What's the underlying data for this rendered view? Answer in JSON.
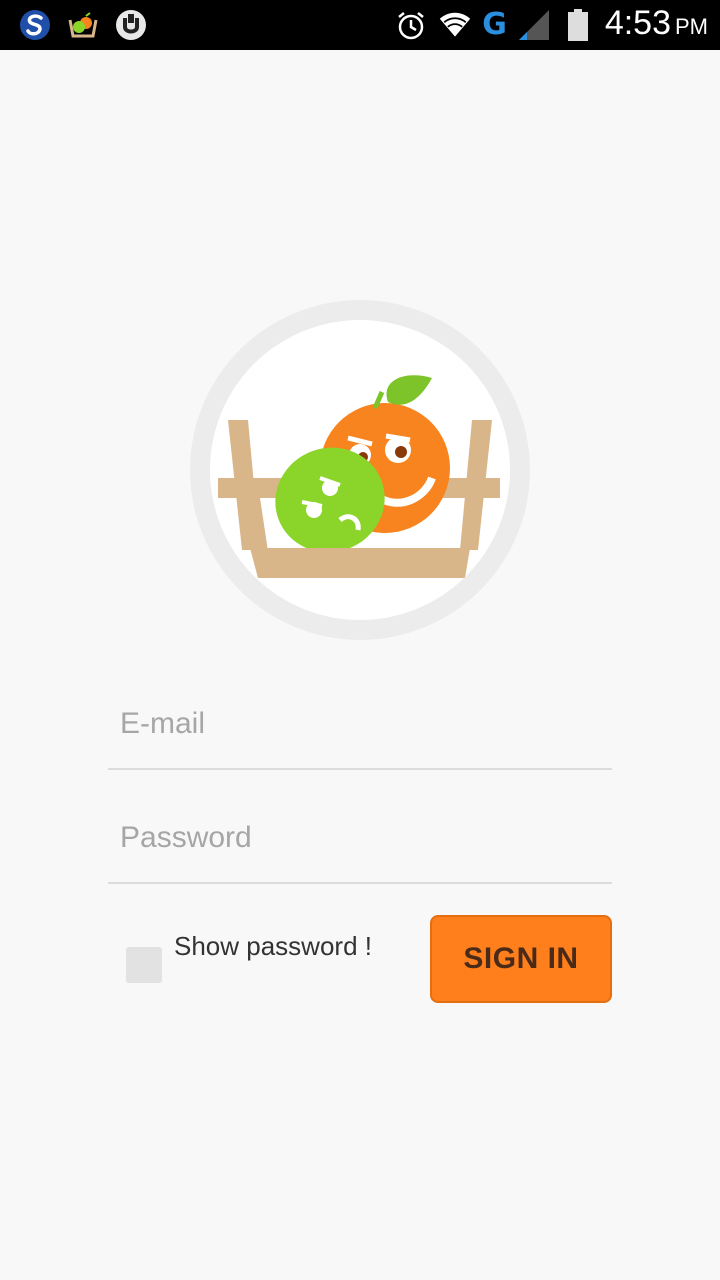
{
  "status_bar": {
    "left_icons": [
      "s-app-icon",
      "basket-app-icon",
      "torrent-app-icon"
    ],
    "right_icons": [
      "alarm-icon",
      "wifi-icon",
      "signal-icon",
      "battery-icon"
    ],
    "network_type": "G",
    "time": "4:53",
    "ampm": "PM"
  },
  "logo": {
    "icon": "fruit-basket-logo",
    "colors": {
      "basket": "#d8b68a",
      "orange": "#f7841f",
      "lime": "#8bd42a",
      "leaf": "#7cc42a"
    }
  },
  "login_form": {
    "email_placeholder": "E-mail",
    "email_value": "",
    "password_placeholder": "Password",
    "password_value": "",
    "show_password_label": "Show password !",
    "show_password_checked": false,
    "sign_in_label": "SIGN IN"
  },
  "colors": {
    "accent": "#ff7f1c",
    "background": "#f8f8f8",
    "status_bar": "#000000"
  }
}
